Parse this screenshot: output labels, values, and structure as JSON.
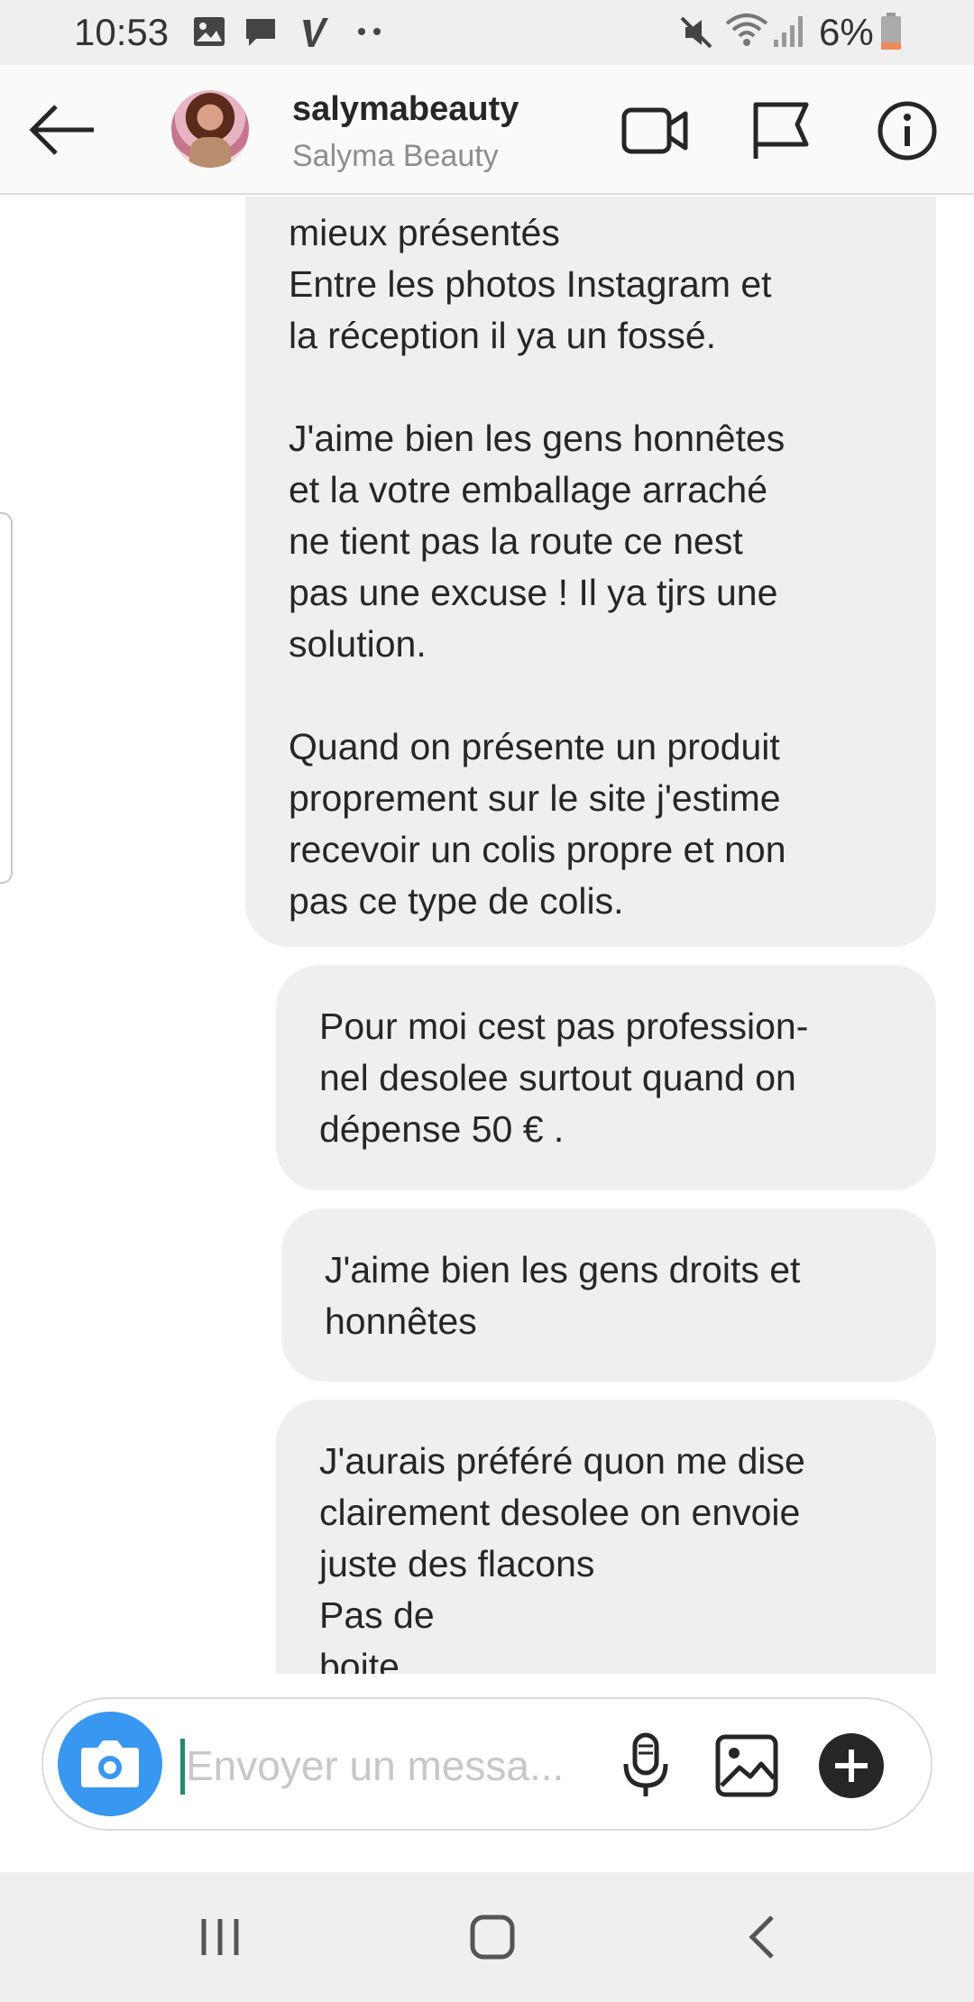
{
  "status_bar": {
    "time": "10:53",
    "battery": "6%",
    "icons": [
      "image-icon",
      "chat-icon",
      "vimeo-icon",
      "more-dots-icon",
      "mute-icon",
      "wifi-icon",
      "signal-icon",
      "battery-icon"
    ]
  },
  "header": {
    "username": "salymabeauty",
    "full_name": "Salyma Beauty",
    "icons": [
      "back-arrow-icon",
      "video-call-icon",
      "flag-icon",
      "info-icon"
    ]
  },
  "messages": [
    {
      "text": "mieux présentés\nEntre les photos Instagram et\nla réception il ya un fossé.\n\nJ'aime bien les gens honnêtes\net la votre emballage arraché\nne tient pas la route ce nest\npas une excuse ! Il ya tjrs une\nsolution.\n\nQuand on présente un produit\nproprement sur le site j'estime\nrecevoir un colis propre et non\npas ce type de colis."
    },
    {
      "text": "Pour moi cest pas profession-\nnel desolee surtout quand on\ndépense 50 € ."
    },
    {
      "text": "J'aime bien les gens droits et\nhonnêtes"
    },
    {
      "text": "J'aurais préféré quon me dise\nclairement desolee on envoie\njuste des flacons\nPas de\nboite"
    }
  ],
  "composer": {
    "placeholder": "Envoyer un messa...",
    "icons": [
      "camera-icon",
      "microphone-icon",
      "gallery-icon",
      "plus-icon"
    ]
  },
  "navbar": {
    "icons": [
      "recent-apps-icon",
      "home-icon",
      "back-icon"
    ]
  },
  "colors": {
    "bubble": "#efefef",
    "camera_button": "#3897f0",
    "caret": "#1e8a6e"
  }
}
